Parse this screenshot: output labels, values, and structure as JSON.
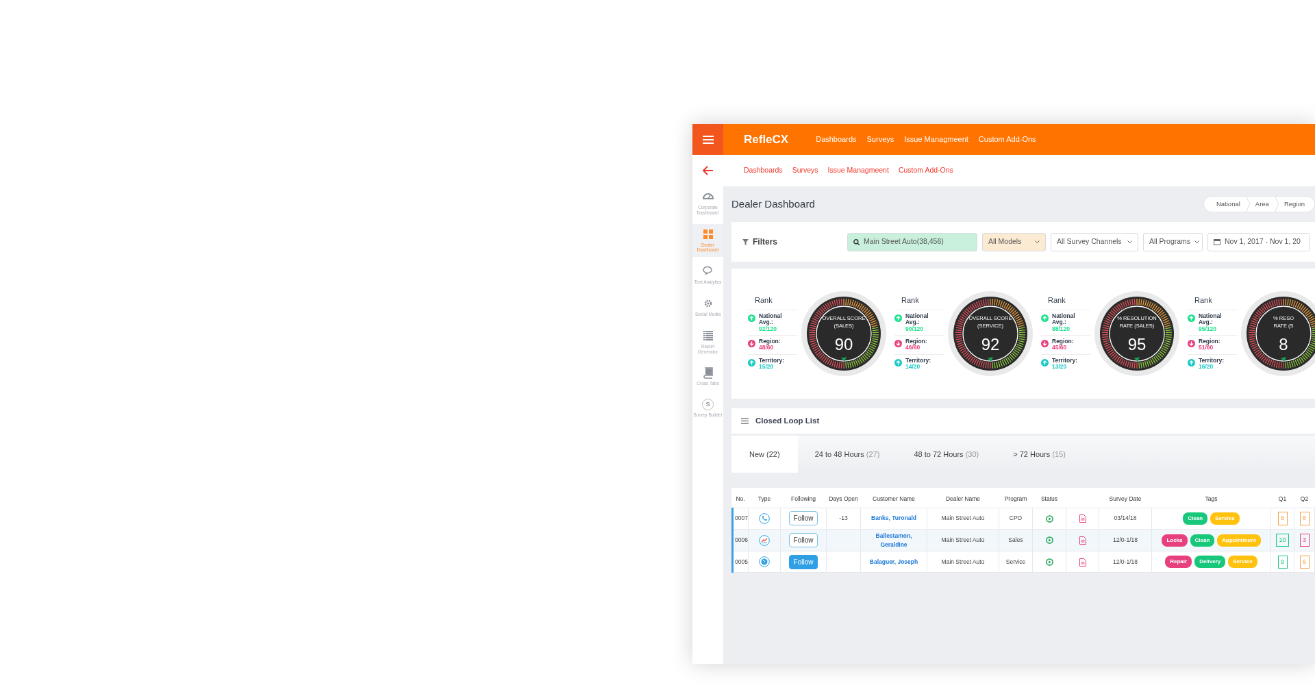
{
  "brand": "RefleCX",
  "top_nav": [
    "Dashboards",
    "Surveys",
    "Issue Managmeent",
    "Custom Add-Ons"
  ],
  "sub_nav": [
    "Dashboards",
    "Surveys",
    "Issue Managmeent",
    "Custom Add-Ons"
  ],
  "sidebar": {
    "items": [
      {
        "label": "Corporate Dashboard",
        "kind": "gauge",
        "selected": false
      },
      {
        "label": "Dealer Dashboard",
        "kind": "grid",
        "selected": true
      },
      {
        "label": "Text Analytics",
        "kind": "chat",
        "selected": false
      },
      {
        "label": "Social Media",
        "kind": "gear",
        "selected": false
      },
      {
        "label": "Report Generator",
        "kind": "list",
        "selected": false
      },
      {
        "label": "Cross Tabs",
        "kind": "book",
        "selected": false
      },
      {
        "label": "Survey Builder",
        "kind": "letter",
        "icon_text": "S",
        "selected": false
      }
    ]
  },
  "page_title": "Dealer Dashboard",
  "breadcrumb": [
    "National",
    "Area",
    "Region"
  ],
  "filters": {
    "title": "Filters",
    "controls": [
      {
        "kind": "search",
        "value": "Main Street Auto(38,456)",
        "color": "#c8f0dc"
      },
      {
        "kind": "select",
        "value": "All Models",
        "color": "#fcebd3"
      },
      {
        "kind": "select",
        "value": "All Survey Channels"
      },
      {
        "kind": "select",
        "value": "All Programs"
      },
      {
        "kind": "date",
        "value": "Nov 1, 2017 - Nov 1, 20"
      }
    ]
  },
  "scores": [
    {
      "rank_title": "Rank",
      "ranks": [
        {
          "label": "National Avg.:",
          "value": "92/120",
          "kind": "up",
          "color": "#1de28e"
        },
        {
          "label": "Region:",
          "value": "48/60",
          "kind": "down",
          "color": "#e8407f"
        },
        {
          "label": "Territory:",
          "value": "15/20",
          "kind": "up",
          "color": "#1cc9c6"
        }
      ],
      "gauge_lines": [
        "OVERALL SCORE",
        "(SALES)"
      ],
      "score": "90"
    },
    {
      "rank_title": "Rank",
      "ranks": [
        {
          "label": "National Avg.:",
          "value": "90/120",
          "kind": "up",
          "color": "#1de28e"
        },
        {
          "label": "Region:",
          "value": "46/60",
          "kind": "down",
          "color": "#e8407f"
        },
        {
          "label": "Territory:",
          "value": "14/20",
          "kind": "up",
          "color": "#1cc9c6"
        }
      ],
      "gauge_lines": [
        "OVERALL SCORE",
        "(SERVICE)"
      ],
      "score": "92"
    },
    {
      "rank_title": "Rank",
      "ranks": [
        {
          "label": "National Avg.:",
          "value": "88/120",
          "kind": "up",
          "color": "#1de28e"
        },
        {
          "label": "Region:",
          "value": "45/60",
          "kind": "down",
          "color": "#e8407f"
        },
        {
          "label": "Territory:",
          "value": "13/20",
          "kind": "up",
          "color": "#1cc9c6"
        }
      ],
      "gauge_lines": [
        "% RESOLUTION",
        "RATE (SALES)"
      ],
      "score": "95"
    },
    {
      "rank_title": "Rank",
      "ranks": [
        {
          "label": "National Avg.:",
          "value": "95/120",
          "kind": "up",
          "color": "#1de28e"
        },
        {
          "label": "Region:",
          "value": "51/60",
          "kind": "down",
          "color": "#e8407f"
        },
        {
          "label": "Territory:",
          "value": "16/20",
          "kind": "up",
          "color": "#1cc9c6"
        }
      ],
      "gauge_lines": [
        "% RESO",
        "RATE (S"
      ],
      "score": "8"
    }
  ],
  "closed_loop": {
    "title": "Closed Loop List",
    "tabs": [
      {
        "label": "New",
        "count": "(22)",
        "selected": true
      },
      {
        "label": "24 to 48 Hours",
        "count": "(27)",
        "selected": false
      },
      {
        "label": "48 to 72 Hours",
        "count": "(30)",
        "selected": false
      },
      {
        "label": "> 72 Hours",
        "count": "(15)",
        "selected": false
      }
    ]
  },
  "table": {
    "columns": [
      {
        "label": "No."
      },
      {
        "label": "Type"
      },
      {
        "label": "Following"
      },
      {
        "label": "Days Open"
      },
      {
        "label": "Customer Name"
      },
      {
        "label": "Dealer Name"
      },
      {
        "label": "Program"
      },
      {
        "label": "Status"
      },
      {
        "kind": "blank"
      },
      {
        "label": "Survey Date"
      },
      {
        "label": "Tags"
      },
      {
        "label": "Q1"
      },
      {
        "label": "Q2"
      }
    ],
    "rows": [
      {
        "no": "0007",
        "kind": "phone",
        "follow_label": "Follow",
        "following": false,
        "days_open": "-13",
        "customer": "Banks, Turonald",
        "dealer": "Main Street Auto",
        "program": "CPO",
        "survey_date": "03/14/18",
        "tags": [
          {
            "label": "Clean",
            "color": "#17c77a"
          },
          {
            "label": "Service",
            "color": "#ffc20e"
          }
        ],
        "q1": {
          "value": "8",
          "color": "#f5a04a"
        },
        "q2": {
          "value": "8",
          "color": "#f5a04a"
        }
      },
      {
        "no": "0006",
        "kind": "survey",
        "follow_label": "Follow",
        "following": false,
        "customer": "Ballestamon, Geraldine",
        "dealer": "Main Street Auto",
        "program": "Sales",
        "survey_date": "12/0-1/18",
        "tags": [
          {
            "label": "Locks",
            "color": "#e8407f"
          },
          {
            "label": "Clean",
            "color": "#17c77a"
          },
          {
            "label": "Appointment",
            "color": "#ffc20e"
          }
        ],
        "q1": {
          "value": "10",
          "color": "#17c77a"
        },
        "q2": {
          "value": "3",
          "color": "#e8407f"
        }
      },
      {
        "no": "0005",
        "kind": "web",
        "follow_label": "Follow",
        "following": true,
        "customer": "Balaguer, Joseph",
        "dealer": "Main Street Auto",
        "program": "Service",
        "survey_date": "12/0-1/18",
        "tags": [
          {
            "label": "Repair",
            "color": "#e8407f"
          },
          {
            "label": "Delivery",
            "color": "#17c77a"
          },
          {
            "label": "Service",
            "color": "#ffc20e"
          }
        ],
        "q1": {
          "value": "9",
          "color": "#17c77a"
        },
        "q2": {
          "value": "6",
          "color": "#f5a04a"
        }
      }
    ]
  }
}
